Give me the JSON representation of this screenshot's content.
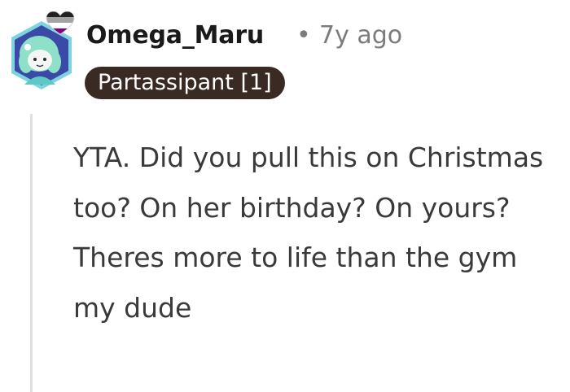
{
  "comment": {
    "author": "Omega_Maru",
    "separator": "•",
    "timestamp": "7y ago",
    "flair": "Partassipant [1]",
    "body": "YTA. Did you pull this on Christmas too? On her birthday? On yours? Theres more to life than the gym my dude"
  },
  "avatar": {
    "icon": "snoo-avatar-icon",
    "hat_icon": "pride-heart-icon",
    "colors": {
      "frame": "#7fd3e0",
      "background": "#3a4aa6",
      "hair": "#8fe0c8",
      "body": "#5ec9c2"
    }
  },
  "colors": {
    "username": "#1a1a1b",
    "meta": "#7c7c7c",
    "flair_bg": "#3a2a24",
    "flair_text": "#ffffff",
    "body_text": "#3a3a3a",
    "thread_line": "#e0e0e0"
  }
}
